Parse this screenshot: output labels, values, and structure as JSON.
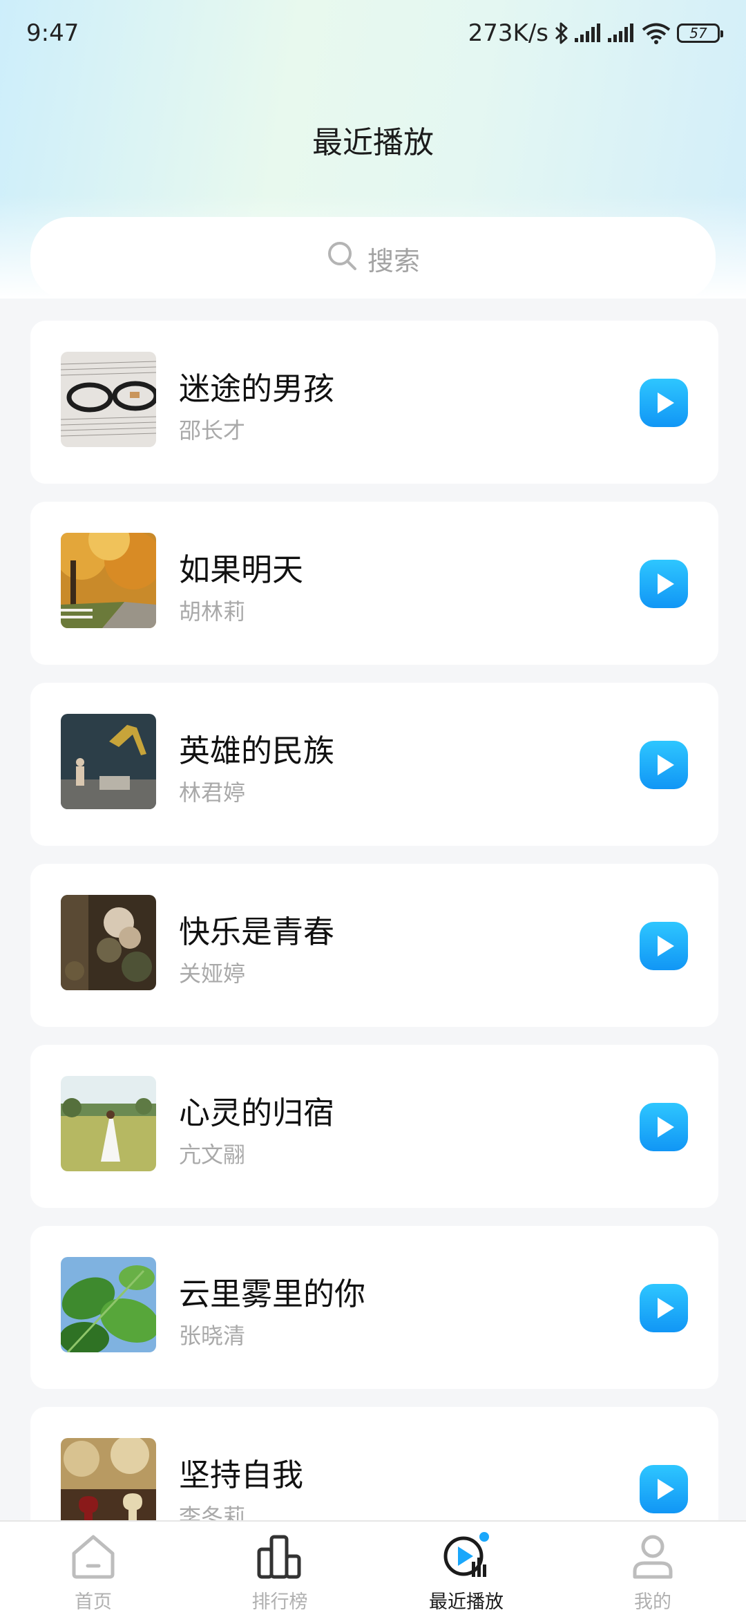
{
  "status_bar": {
    "time": "9:47",
    "net_speed": "273K/s",
    "battery": "57"
  },
  "header": {
    "title": "最近播放"
  },
  "search": {
    "placeholder": "搜索"
  },
  "songs": [
    {
      "title": "迷途的男孩",
      "artist": "邵长才"
    },
    {
      "title": "如果明天",
      "artist": "胡林莉"
    },
    {
      "title": "英雄的民族",
      "artist": "林君婷"
    },
    {
      "title": "快乐是青春",
      "artist": "关娅婷"
    },
    {
      "title": "心灵的归宿",
      "artist": "亢文翮"
    },
    {
      "title": "云里雾里的你",
      "artist": "张晓清"
    },
    {
      "title": "坚持自我",
      "artist": "李冬莉"
    }
  ],
  "tabs": [
    {
      "label": "首页",
      "icon": "home-icon"
    },
    {
      "label": "排行榜",
      "icon": "ranking-icon"
    },
    {
      "label": "最近播放",
      "icon": "recent-play-icon",
      "active": true
    },
    {
      "label": "我的",
      "icon": "profile-icon"
    }
  ],
  "colors": {
    "accent": "#1aa7fb",
    "play_button_top": "#2ec6ff",
    "play_button_bottom": "#1196f5",
    "list_background": "#f5f6f8",
    "muted_text": "#a9a9a9"
  }
}
